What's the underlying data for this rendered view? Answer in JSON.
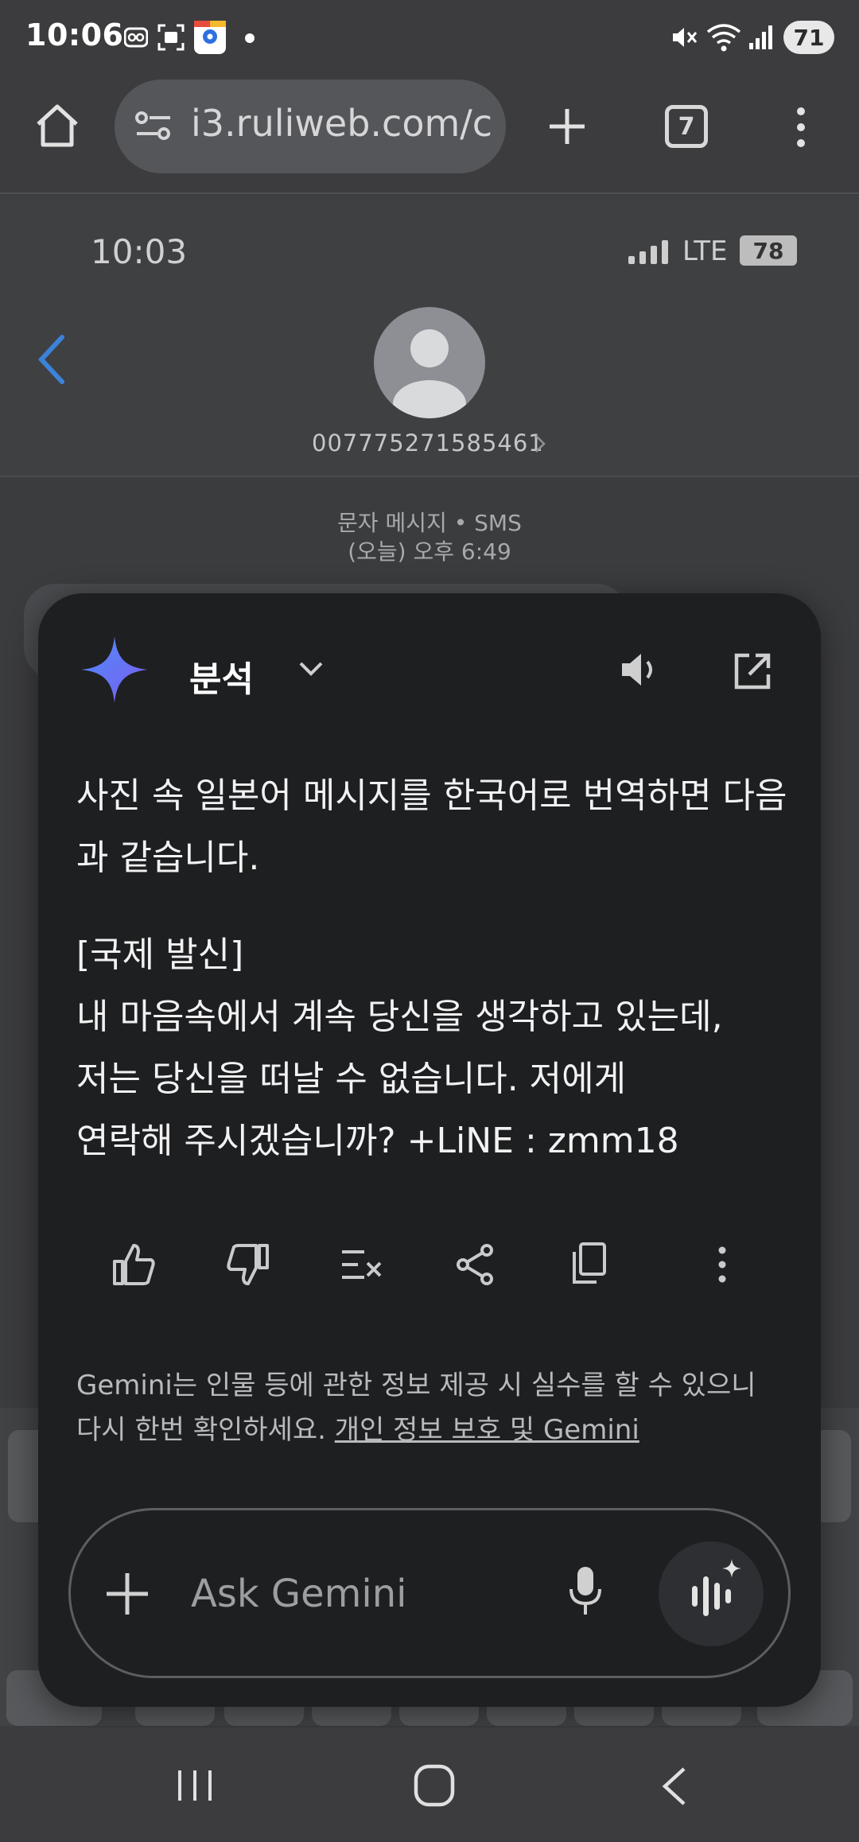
{
  "status_bar": {
    "time": "10:06",
    "battery": "71",
    "icons": [
      "voicemail-icon",
      "screenshot-icon",
      "map-app-icon",
      "dot-icon",
      "mute-icon",
      "wifi-icon",
      "signal-icon",
      "battery-icon"
    ]
  },
  "browser": {
    "url": "i3.ruliweb.com/c",
    "tab_count": "7",
    "icons": [
      "home-icon",
      "site-info-icon",
      "new-tab-icon",
      "tabs-icon",
      "more-vert-icon"
    ]
  },
  "sms_screen": {
    "time": "10:03",
    "network": "LTE",
    "battery": "78",
    "contact_number": "007775271585461",
    "message_type": "문자 메시지 • SMS",
    "message_time": "(오늘) 오후 6:49"
  },
  "gemini": {
    "title": "분석",
    "intro": "사진 속 일본어 메시지를 한국어로 번역하면 다음과 같습니다.",
    "translation_lines": [
      "[국제 발신]",
      "내 마음속에서 계속 당신을 생각하고 있는데,",
      "저는 당신을 떠날 수 없습니다. 저에게",
      "연락해 주시겠습니까? +LiNE : zmm18"
    ],
    "disclaimer_text": "Gemini는 인물 등에 관한 정보 제공 시 실수를 할 수 있으니 다시 한번 확인하세요. ",
    "disclaimer_link": "개인 정보 보호 및 Gemini",
    "input_placeholder": "Ask Gemini",
    "colors": {
      "accent_star_start": "#4f8df9",
      "accent_star_end": "#7b5cf0",
      "panel_bg": "#1e1f21"
    }
  }
}
